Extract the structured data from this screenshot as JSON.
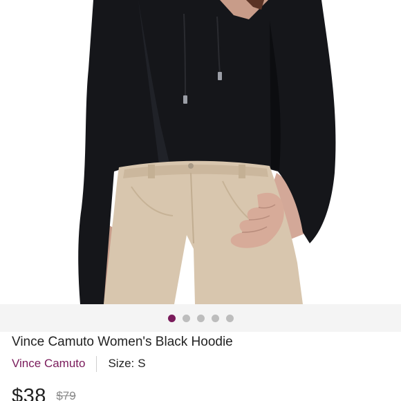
{
  "product": {
    "title": "Vince Camuto Women's Black Hoodie",
    "brand": "Vince Camuto",
    "size_label": "Size:",
    "size_value": "S",
    "price": "$38",
    "original_price": "$79"
  },
  "gallery": {
    "image_count": 5,
    "active_index": 0
  },
  "colors": {
    "accent": "#7a1b5b",
    "dot_inactive": "#bdbdbd",
    "hoodie": "#15161a",
    "pants": "#d8c6ae",
    "skin": "#d8aa96"
  }
}
